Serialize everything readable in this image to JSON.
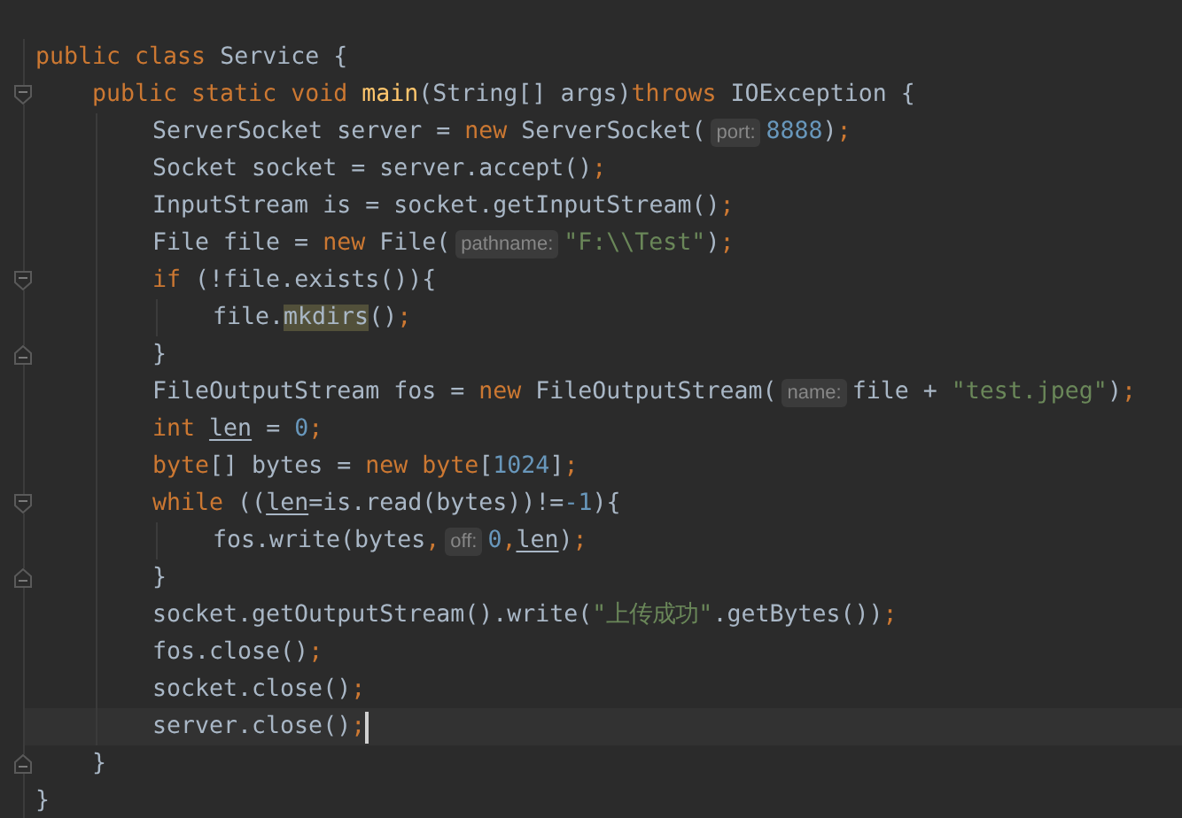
{
  "lines": [
    {
      "tokens": [
        {
          "kind": "kw",
          "text": "public class "
        },
        {
          "kind": "plain",
          "text": "Service {"
        }
      ],
      "children": [
        {
          "kind": "block_start",
          "tokens": [
            {
              "kind": "kw",
              "text": "public static void "
            },
            {
              "kind": "decl",
              "text": "main"
            },
            {
              "kind": "plain",
              "text": "(String[] args)"
            },
            {
              "kind": "kw",
              "text": "throws "
            },
            {
              "kind": "plain",
              "text": "IOException {"
            }
          ],
          "children": [
            {
              "tokens": [
                {
                  "kind": "plain",
                  "text": "ServerSocket server = "
                },
                {
                  "kind": "kw",
                  "text": "new "
                },
                {
                  "kind": "plain",
                  "text": "ServerSocket("
                },
                {
                  "kind": "hint",
                  "text": "port:"
                },
                {
                  "kind": "num",
                  "text": "8888"
                },
                {
                  "kind": "plain",
                  "text": ")"
                },
                {
                  "kind": "punct",
                  "text": ";"
                }
              ]
            },
            {
              "tokens": [
                {
                  "kind": "plain",
                  "text": "Socket socket = server.accept()"
                },
                {
                  "kind": "punct",
                  "text": ";"
                }
              ]
            },
            {
              "tokens": [
                {
                  "kind": "plain",
                  "text": "InputStream is = socket.getInputStream()"
                },
                {
                  "kind": "punct",
                  "text": ";"
                }
              ]
            },
            {
              "tokens": [
                {
                  "kind": "plain",
                  "text": "File file = "
                },
                {
                  "kind": "kw",
                  "text": "new "
                },
                {
                  "kind": "plain",
                  "text": "File("
                },
                {
                  "kind": "hint",
                  "text": "pathname:"
                },
                {
                  "kind": "str",
                  "text": "\"F:\\\\Test\""
                },
                {
                  "kind": "plain",
                  "text": ")"
                },
                {
                  "kind": "punct",
                  "text": ";"
                }
              ]
            },
            {
              "kind": "block_start",
              "tokens": [
                {
                  "kind": "kw",
                  "text": "if "
                },
                {
                  "kind": "plain",
                  "text": "(!file.exists()){"
                }
              ],
              "children": [
                {
                  "tokens": [
                    {
                      "kind": "plain",
                      "text": "file."
                    },
                    {
                      "kind": "match",
                      "text": "mkdirs"
                    },
                    {
                      "kind": "plain",
                      "text": "()"
                    },
                    {
                      "kind": "punct",
                      "text": ";"
                    }
                  ]
                }
              ]
            },
            {
              "kind": "block_end",
              "tokens": [
                {
                  "kind": "plain",
                  "text": "}"
                }
              ]
            },
            {
              "tokens": [
                {
                  "kind": "plain",
                  "text": "FileOutputStream fos = "
                },
                {
                  "kind": "kw",
                  "text": "new "
                },
                {
                  "kind": "plain",
                  "text": "FileOutputStream("
                },
                {
                  "kind": "hint",
                  "text": "name:"
                },
                {
                  "kind": "plain",
                  "text": "file + "
                },
                {
                  "kind": "str",
                  "text": "\"test.jpeg\""
                },
                {
                  "kind": "plain",
                  "text": ")"
                },
                {
                  "kind": "punct",
                  "text": ";"
                }
              ]
            },
            {
              "tokens": [
                {
                  "kind": "kw",
                  "text": "int "
                },
                {
                  "kind": "var",
                  "text": "len"
                },
                {
                  "kind": "plain",
                  "text": " = "
                },
                {
                  "kind": "num",
                  "text": "0"
                },
                {
                  "kind": "punct",
                  "text": ";"
                }
              ]
            },
            {
              "tokens": [
                {
                  "kind": "kw",
                  "text": "byte"
                },
                {
                  "kind": "plain",
                  "text": "[] bytes = "
                },
                {
                  "kind": "kw",
                  "text": "new byte"
                },
                {
                  "kind": "plain",
                  "text": "["
                },
                {
                  "kind": "num",
                  "text": "1024"
                },
                {
                  "kind": "plain",
                  "text": "]"
                },
                {
                  "kind": "punct",
                  "text": ";"
                }
              ]
            },
            {
              "kind": "block_start",
              "tokens": [
                {
                  "kind": "kw",
                  "text": "while "
                },
                {
                  "kind": "plain",
                  "text": "(("
                },
                {
                  "kind": "var",
                  "text": "len"
                },
                {
                  "kind": "plain",
                  "text": "=is.read(bytes))!="
                },
                {
                  "kind": "num",
                  "text": "-1"
                },
                {
                  "kind": "plain",
                  "text": "){"
                }
              ],
              "children": [
                {
                  "tokens": [
                    {
                      "kind": "plain",
                      "text": "fos.write(bytes"
                    },
                    {
                      "kind": "punct",
                      "text": ","
                    },
                    {
                      "kind": "hint",
                      "text": "off:"
                    },
                    {
                      "kind": "num",
                      "text": "0"
                    },
                    {
                      "kind": "punct",
                      "text": ","
                    },
                    {
                      "kind": "var",
                      "text": "len"
                    },
                    {
                      "kind": "plain",
                      "text": ")"
                    },
                    {
                      "kind": "punct",
                      "text": ";"
                    }
                  ]
                }
              ]
            },
            {
              "kind": "block_end",
              "tokens": [
                {
                  "kind": "plain",
                  "text": "}"
                }
              ]
            },
            {
              "tokens": [
                {
                  "kind": "plain",
                  "text": "socket.getOutputStream().write("
                },
                {
                  "kind": "str",
                  "text": "\"上传成功\""
                },
                {
                  "kind": "plain",
                  "text": ".getBytes())"
                },
                {
                  "kind": "punct",
                  "text": ";"
                }
              ]
            },
            {
              "tokens": [
                {
                  "kind": "plain",
                  "text": "fos.close()"
                },
                {
                  "kind": "punct",
                  "text": ";"
                }
              ]
            },
            {
              "tokens": [
                {
                  "kind": "plain",
                  "text": "socket.close()"
                },
                {
                  "kind": "punct",
                  "text": ";"
                }
              ]
            },
            {
              "current": true,
              "tokens": [
                {
                  "kind": "plain",
                  "text": "server.close()"
                },
                {
                  "kind": "punct",
                  "text": ";"
                }
              ]
            }
          ]
        },
        {
          "kind": "block_end",
          "tokens": [
            {
              "kind": "plain",
              "text": "}"
            }
          ]
        }
      ]
    },
    {
      "tokens": [
        {
          "kind": "plain",
          "text": "}"
        }
      ]
    }
  ]
}
